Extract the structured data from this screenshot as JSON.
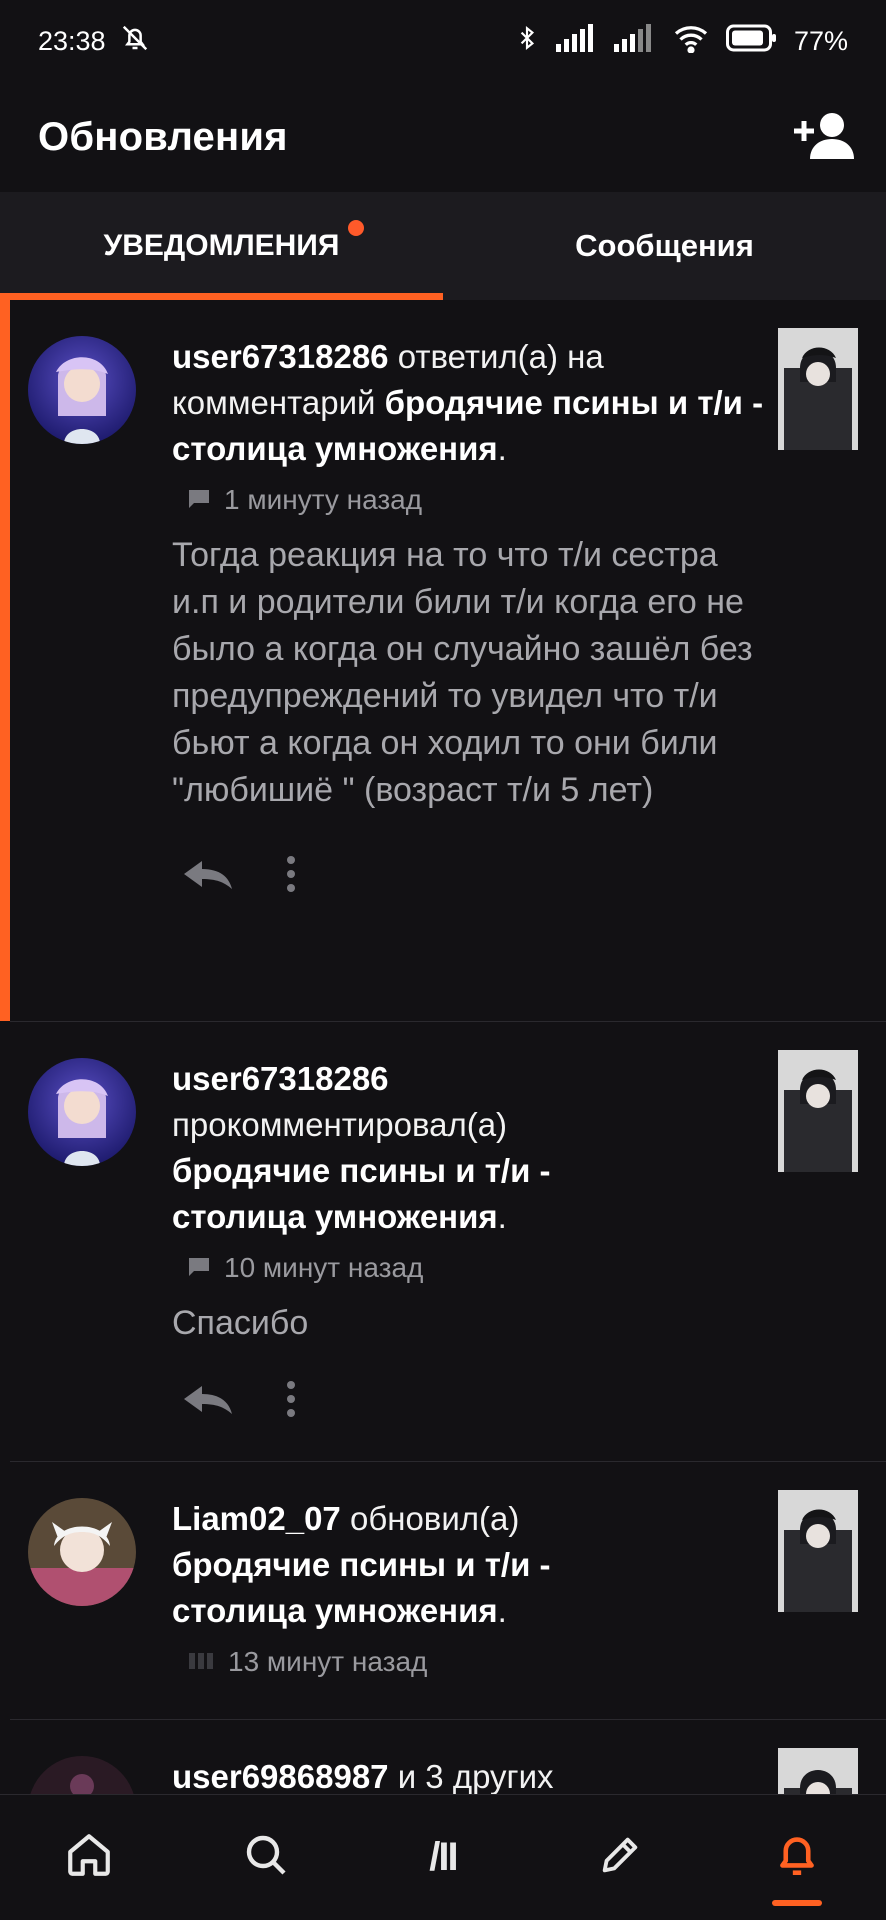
{
  "status_bar": {
    "time": "23:38",
    "battery": "77%"
  },
  "app_bar": {
    "title": "Обновления"
  },
  "tabs": [
    {
      "label": "УВЕДОМЛЕНИЯ",
      "active": true
    },
    {
      "label": "Сообщения",
      "active": false
    }
  ],
  "notifications": [
    {
      "user": "user67318286",
      "action": " ответил(а) на комментарий ",
      "story": "бродячие псины и т/и - столица умножения",
      "period": ".",
      "time": "1 минуту назад",
      "body": "Тогда реакция на то что т/и сестра и.п и родители били т/и когда его не было а когда он случайно зашёл без предупреждений то увидел что т/и бьют а когда он ходил то они били \"любишиё \" (возраст т/и 5 лет)"
    },
    {
      "user": "user67318286",
      "action": " прокомментировал(а) ",
      "story": "бродячие псины и т/и - столица умножения",
      "period": ".",
      "time": "10 минут назад",
      "body": "Спасибо"
    },
    {
      "user": "Liam02_07",
      "action": " обновил(а) ",
      "story": "бродячие псины и т/и - столица умножения",
      "period": ".",
      "time": "13 минут назад"
    },
    {
      "user": "user69868987",
      "action": " и 3 других"
    }
  ],
  "bottom_nav": [
    {
      "icon": "home-icon"
    },
    {
      "icon": "search-icon"
    },
    {
      "icon": "library-icon",
      "text": "/II"
    },
    {
      "icon": "pencil-icon"
    },
    {
      "icon": "bell-icon",
      "active": true
    }
  ],
  "colors": {
    "accent": "#ff6122",
    "background": "#121114",
    "tab_bar": "#1c1b1f"
  }
}
